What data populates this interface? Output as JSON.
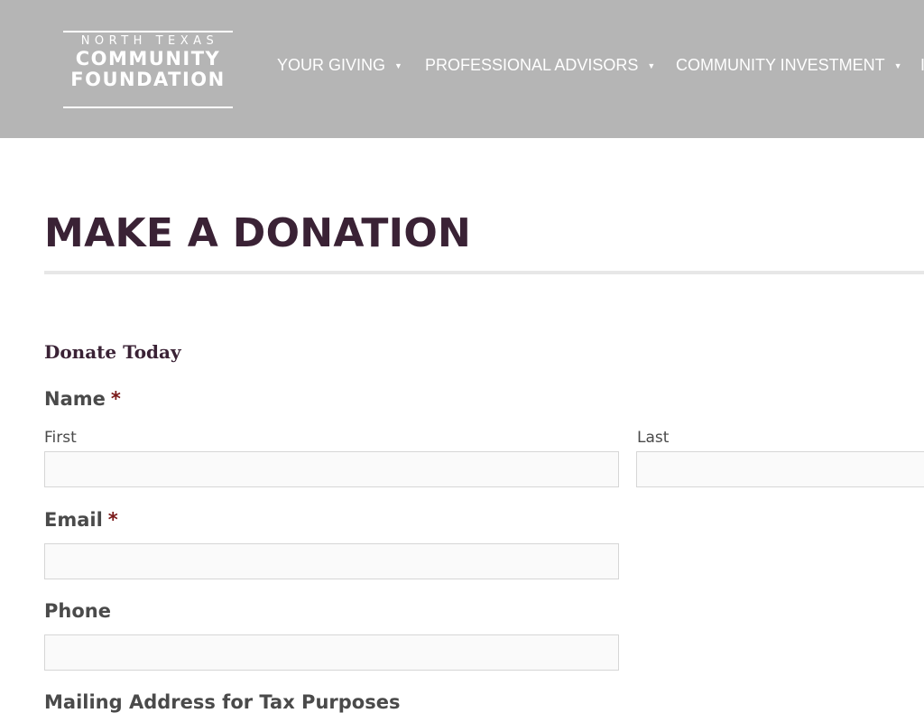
{
  "logo": {
    "line1": "NORTH TEXAS",
    "line2": "COMMUNITY",
    "line3": "FOUNDATION"
  },
  "nav": {
    "items": [
      {
        "label": "YOUR GIVING",
        "caret": "▼"
      },
      {
        "label": "PROFESSIONAL ADVISORS",
        "caret": "▼"
      },
      {
        "label": "COMMUNITY INVESTMENT",
        "caret": "▼"
      },
      {
        "label": "I"
      }
    ]
  },
  "page": {
    "title": "MAKE A DONATION"
  },
  "form": {
    "heading": "Donate Today",
    "required_marker": "*",
    "name": {
      "label": "Name",
      "first_label": "First",
      "last_label": "Last",
      "first_value": "",
      "last_value": ""
    },
    "email": {
      "label": "Email",
      "value": ""
    },
    "phone": {
      "label": "Phone",
      "value": ""
    },
    "mailing": {
      "label": "Mailing Address for Tax Purposes"
    }
  },
  "colors": {
    "header_bg": "#b5b5b5",
    "title": "#3a2235",
    "required": "#7a1818"
  }
}
